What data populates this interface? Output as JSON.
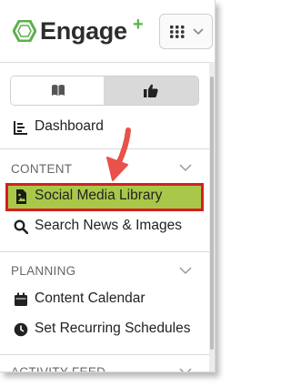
{
  "header": {
    "logo_text": "Engage",
    "logo_plus": "+",
    "apps_icon": "grid-icon",
    "apps_chevron": "chevron-down-icon"
  },
  "view_toggle": {
    "left_icon": "book-icon",
    "right_icon": "thumbs-up-icon",
    "active": "right"
  },
  "nav": {
    "dashboard": {
      "label": "Dashboard",
      "icon": "chart-icon"
    },
    "content": {
      "title": "CONTENT",
      "items": [
        {
          "label": "Social Media Library",
          "icon": "image-file-icon"
        },
        {
          "label": "Search News & Images",
          "icon": "search-icon"
        }
      ]
    },
    "planning": {
      "title": "PLANNING",
      "items": [
        {
          "label": "Content Calendar",
          "icon": "calendar-icon"
        },
        {
          "label": "Set Recurring Schedules",
          "icon": "clock-icon"
        }
      ]
    },
    "activity_feed": {
      "title": "ACTIVITY FEED"
    }
  },
  "colors": {
    "highlight_fill": "#a9c84a",
    "highlight_border": "#d42020",
    "arrow": "#e8524a",
    "brand_green": "#5bb14a"
  }
}
